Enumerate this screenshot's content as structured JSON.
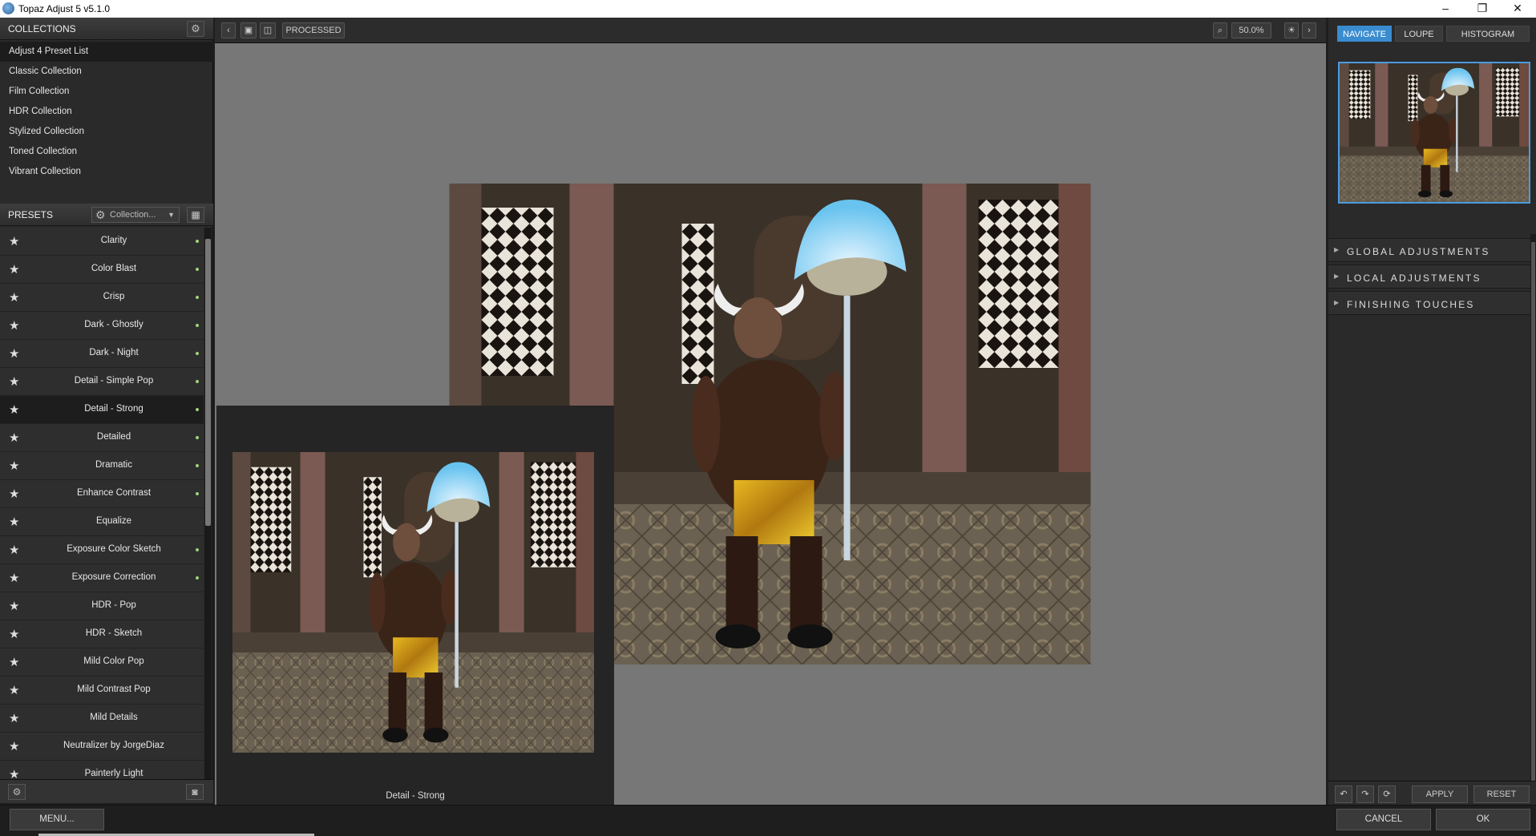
{
  "window": {
    "title": "Topaz Adjust 5 v5.1.0",
    "controls": [
      "–",
      "❐",
      "✕"
    ]
  },
  "collections": {
    "header": "COLLECTIONS",
    "items": [
      "Adjust 4 Preset List",
      "Classic Collection",
      "Film Collection",
      "HDR Collection",
      "Stylized Collection",
      "Toned Collection",
      "Vibrant Collection"
    ],
    "selected": "Adjust 4 Preset List"
  },
  "presets": {
    "header": "PRESETS",
    "collection_dropdown": "Collection...",
    "items": [
      "Clarity",
      "Color Blast",
      "Crisp",
      "Dark - Ghostly",
      "Dark - Night",
      "Detail - Simple Pop",
      "Detail - Strong",
      "Detailed",
      "Dramatic",
      "Enhance Contrast",
      "Equalize",
      "Exposure Color Sketch",
      "Exposure Correction",
      "HDR - Pop",
      "HDR - Sketch",
      "Mild Color Pop",
      "Mild Contrast Pop",
      "Mild Details",
      "Neutralizer by JorgeDiaz",
      "Painterly Light"
    ],
    "selected": "Detail - Strong",
    "dotted": [
      true,
      true,
      true,
      true,
      true,
      true,
      true,
      true,
      true,
      true,
      false,
      true,
      true,
      false,
      false,
      false,
      false,
      false,
      false,
      false
    ]
  },
  "toolbar": {
    "processed_label": "PROCESSED",
    "zoom": "50.0%"
  },
  "preview": {
    "caption": "Detail - Strong"
  },
  "right_panel": {
    "tabs": [
      "NAVIGATE",
      "LOUPE",
      "HISTOGRAM"
    ],
    "active_tab": "NAVIGATE",
    "sections": [
      "GLOBAL ADJUSTMENTS",
      "LOCAL ADJUSTMENTS",
      "FINISHING TOUCHES"
    ],
    "apply_label": "APPLY",
    "reset_label": "RESET"
  },
  "statusbar": {
    "menu_label": "MENU...",
    "cancel_label": "CANCEL",
    "ok_label": "OK"
  },
  "colors": {
    "accent": "#3a8cd0",
    "preset_dot": "#9fd27a",
    "canvas_bg": "#777777"
  }
}
